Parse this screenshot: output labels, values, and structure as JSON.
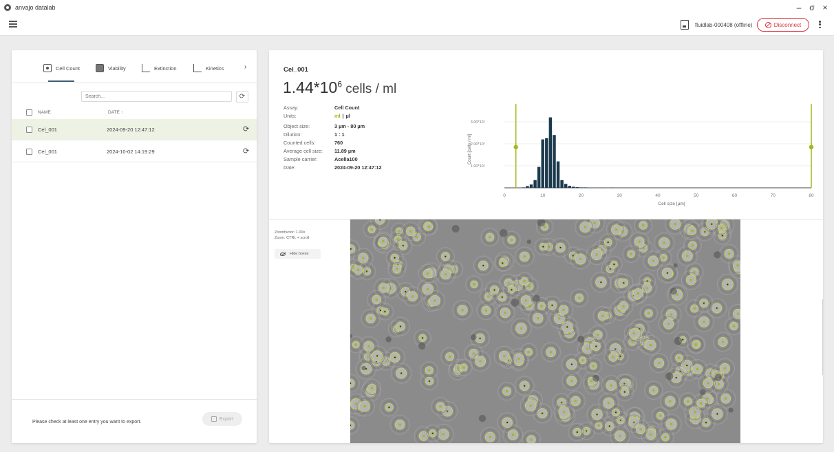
{
  "app": {
    "title": "anvajo datalab",
    "device_label": "fluidlab-000408 (offline)",
    "disconnect_label": "Disconnect",
    "window_controls": [
      "–",
      "σ",
      "×"
    ]
  },
  "tabs": [
    {
      "label": "Cell Count",
      "icon": "cell-count-icon",
      "active": true
    },
    {
      "label": "Viability",
      "icon": "viability-icon",
      "active": false
    },
    {
      "label": "Extinction",
      "icon": "extinction-icon",
      "active": false
    },
    {
      "label": "Kinetics",
      "icon": "kinetics-icon",
      "active": false
    }
  ],
  "tabs_more": "›",
  "search": {
    "placeholder": "Search..."
  },
  "list": {
    "headers": {
      "name": "NAME",
      "date": "DATE ↑"
    },
    "rows": [
      {
        "name": "Cel_001",
        "date": "2024-09-20 12:47:12",
        "selected": true
      },
      {
        "name": "Cel_001",
        "date": "2024-10-02 14:19:29",
        "selected": false
      }
    ]
  },
  "footer": {
    "hint": "Please check at least one entry you want to export.",
    "export_label": "Export"
  },
  "detail": {
    "title": "Cel_001",
    "value_base": "1.44*10",
    "value_exp": "6",
    "value_unit": " cells / ml",
    "props": [
      {
        "key": "Assay:",
        "value": "Cell Count"
      },
      {
        "key": "Units:",
        "value": ""
      },
      {
        "key": "Object size:",
        "value": "3 µm - 80 µm"
      },
      {
        "key": "Dilution:",
        "value": "1 : 1"
      },
      {
        "key": "Counted cells:",
        "value": "760"
      },
      {
        "key": "Average cell size:",
        "value": "11.89 µm"
      },
      {
        "key": "Sample carrier:",
        "value": "Acella100"
      },
      {
        "key": "Date:",
        "value": "2024-09-20 12:47:12"
      }
    ],
    "units": {
      "ml": "ml",
      "ul": "µl"
    }
  },
  "image_view": {
    "zoom_line1": "Zoomfactor: 1.00x",
    "zoom_line2": "Zoom: CTRL + scroll",
    "hide_boxes_label": "Hide boxes"
  },
  "colors": {
    "accent_green": "#9fbb1a",
    "bar_dark": "#1c3a4e",
    "danger_red": "#d9363e",
    "tab_underline": "#3e5a73"
  },
  "chart_data": {
    "type": "bar",
    "title": "",
    "xlabel": "Cell size [µm]",
    "ylabel": "Count [cells / ml]",
    "xlim": [
      0,
      80
    ],
    "ylim": [
      0,
      3.5
    ],
    "x_ticks": [
      0,
      10,
      20,
      30,
      40,
      50,
      60,
      70,
      80
    ],
    "y_ticks": [
      {
        "value": 1,
        "label": "1.00*10⁵"
      },
      {
        "value": 2,
        "label": "2.00*10⁵"
      },
      {
        "value": 3,
        "label": "3.00*10⁵"
      }
    ],
    "gate_range": [
      3,
      80
    ],
    "x": [
      5,
      6,
      7,
      8,
      9,
      10,
      11,
      12,
      13,
      14,
      15,
      16,
      17,
      18,
      19,
      20,
      21,
      22,
      25,
      28
    ],
    "values": [
      0.02,
      0.08,
      0.15,
      0.35,
      0.95,
      2.2,
      2.25,
      3.2,
      2.4,
      1.2,
      0.35,
      0.18,
      0.09,
      0.05,
      0.03,
      0.02,
      0.02,
      0.01,
      0.01,
      0.01
    ]
  }
}
